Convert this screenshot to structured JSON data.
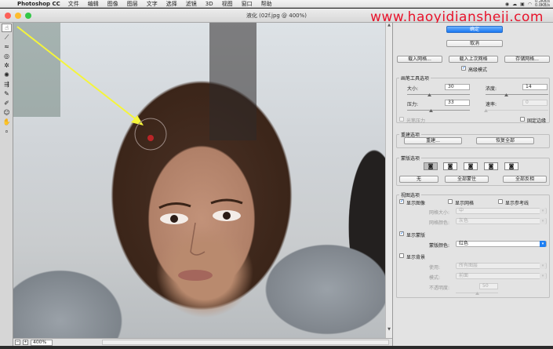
{
  "menubar": {
    "app": "Photoshop CC",
    "items": [
      "文件",
      "编辑",
      "图像",
      "图层",
      "文字",
      "选择",
      "滤镜",
      "3D",
      "视图",
      "窗口",
      "帮助"
    ],
    "net_up": "0.2KB/s",
    "net_down": "0.0KB/s"
  },
  "window": {
    "title": "液化 (02f.jpg @ 400%)",
    "watermark": "www.haoyidiansheji.com"
  },
  "status": {
    "zoom": "400%"
  },
  "buttons": {
    "ok": "确定",
    "cancel": "取消",
    "load_mesh": "载入网格...",
    "load_last_mesh": "载入上次网格",
    "save_mesh": "存储网格...",
    "advanced_mode": "高级模式"
  },
  "brush_options": {
    "title": "画笔工具选项",
    "size_label": "大小:",
    "size": "30",
    "density_label": "浓度:",
    "density": "14",
    "pressure_label": "压力:",
    "pressure": "33",
    "rate_label": "速率:",
    "rate": "0",
    "stylus_label": "光笔压力",
    "pin_edges_label": "固定边缘"
  },
  "reconstruct": {
    "title": "重建选项",
    "reconstruct_btn": "重建...",
    "restore_all_btn": "恢复全部"
  },
  "mask": {
    "title": "蒙版选项",
    "none_btn": "无",
    "mask_all_btn": "全部蒙住",
    "invert_all_btn": "全部反相"
  },
  "view": {
    "title": "视图选项",
    "show_image": "显示图像",
    "show_mesh": "显示网格",
    "show_guides": "显示参考线",
    "mesh_size_label": "网格大小:",
    "mesh_size": "中",
    "mesh_color_label": "网格颜色:",
    "mesh_color": "灰色",
    "show_mask": "显示蒙版",
    "mask_color_label": "蒙版颜色:",
    "mask_color": "红色",
    "show_backdrop": "显示背景",
    "use_label": "使用:",
    "use_value": "所有图层",
    "mode_label": "模式:",
    "mode_value": "前面",
    "opacity_label": "不透明度:",
    "opacity_value": "50"
  },
  "colors": {
    "primary": "#1877f2",
    "watermark": "#e8132b",
    "arrow": "#f5f53a"
  }
}
